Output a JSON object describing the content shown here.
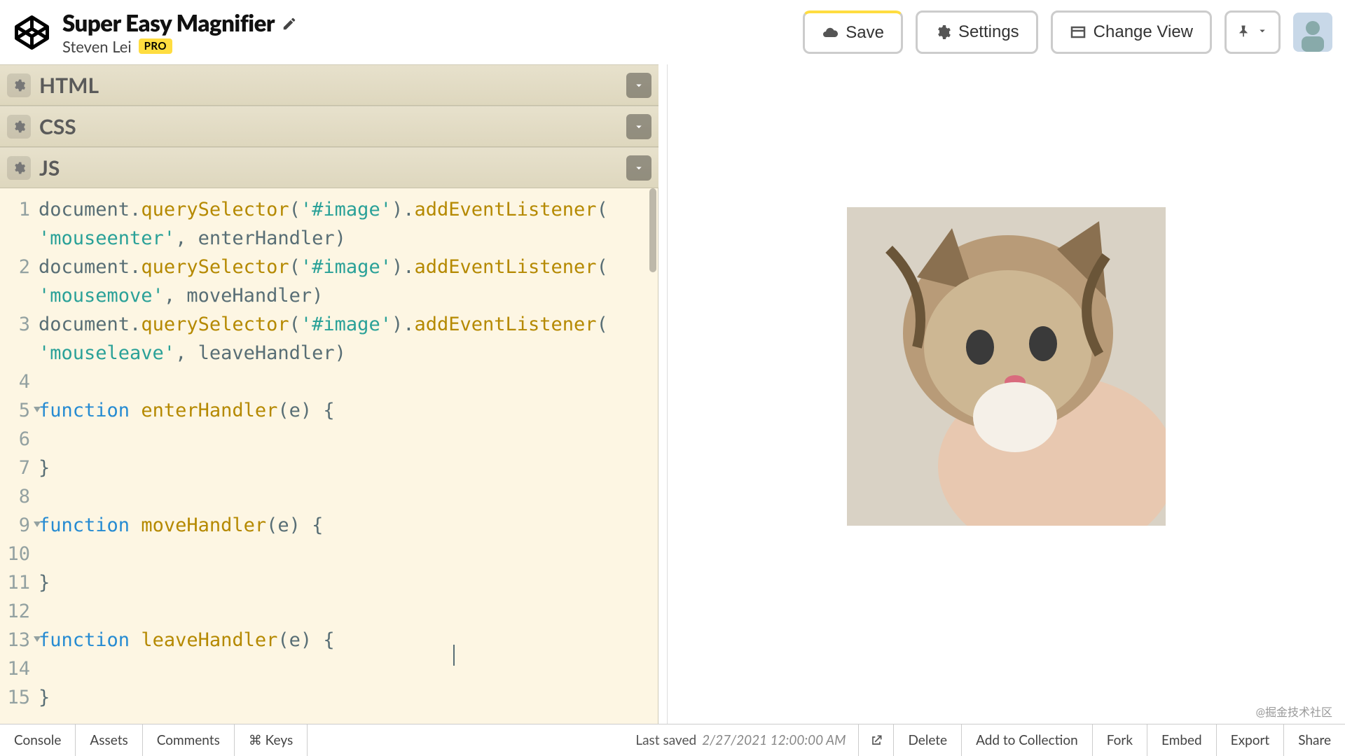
{
  "header": {
    "title": "Super Easy Magnifier",
    "author": "Steven Lei",
    "pro_badge": "PRO",
    "buttons": {
      "save": "Save",
      "settings": "Settings",
      "change_view": "Change View"
    }
  },
  "panels": {
    "html": {
      "title": "HTML"
    },
    "css": {
      "title": "CSS"
    },
    "js": {
      "title": "JS"
    }
  },
  "code": {
    "lines": [
      {
        "n": "1",
        "fold": false,
        "tokens": [
          [
            "id",
            "document"
          ],
          [
            "punct",
            "."
          ],
          [
            "method",
            "querySelector"
          ],
          [
            "punct",
            "("
          ],
          [
            "str",
            "'#image'"
          ],
          [
            "punct",
            ")."
          ],
          [
            "method",
            "addEventListener"
          ],
          [
            "punct",
            "("
          ]
        ]
      },
      {
        "n": "",
        "fold": false,
        "tokens": [
          [
            "str",
            "'mouseenter'"
          ],
          [
            "punct",
            ", "
          ],
          [
            "id",
            "enterHandler"
          ],
          [
            "punct",
            ")"
          ]
        ]
      },
      {
        "n": "2",
        "fold": false,
        "tokens": [
          [
            "id",
            "document"
          ],
          [
            "punct",
            "."
          ],
          [
            "method",
            "querySelector"
          ],
          [
            "punct",
            "("
          ],
          [
            "str",
            "'#image'"
          ],
          [
            "punct",
            ")."
          ],
          [
            "method",
            "addEventListener"
          ],
          [
            "punct",
            "("
          ]
        ]
      },
      {
        "n": "",
        "fold": false,
        "tokens": [
          [
            "str",
            "'mousemove'"
          ],
          [
            "punct",
            ", "
          ],
          [
            "id",
            "moveHandler"
          ],
          [
            "punct",
            ")"
          ]
        ]
      },
      {
        "n": "3",
        "fold": false,
        "tokens": [
          [
            "id",
            "document"
          ],
          [
            "punct",
            "."
          ],
          [
            "method",
            "querySelector"
          ],
          [
            "punct",
            "("
          ],
          [
            "str",
            "'#image'"
          ],
          [
            "punct",
            ")."
          ],
          [
            "method",
            "addEventListener"
          ],
          [
            "punct",
            "("
          ]
        ]
      },
      {
        "n": "",
        "fold": false,
        "tokens": [
          [
            "str",
            "'mouseleave'"
          ],
          [
            "punct",
            ", "
          ],
          [
            "id",
            "leaveHandler"
          ],
          [
            "punct",
            ")"
          ]
        ]
      },
      {
        "n": "4",
        "fold": false,
        "tokens": []
      },
      {
        "n": "5",
        "fold": true,
        "tokens": [
          [
            "kw",
            "function"
          ],
          [
            "punct",
            " "
          ],
          [
            "fn",
            "enterHandler"
          ],
          [
            "punct",
            "("
          ],
          [
            "id",
            "e"
          ],
          [
            "punct",
            ") {"
          ]
        ]
      },
      {
        "n": "6",
        "fold": false,
        "tokens": []
      },
      {
        "n": "7",
        "fold": false,
        "tokens": [
          [
            "punct",
            "}"
          ]
        ]
      },
      {
        "n": "8",
        "fold": false,
        "tokens": []
      },
      {
        "n": "9",
        "fold": true,
        "tokens": [
          [
            "kw",
            "function"
          ],
          [
            "punct",
            " "
          ],
          [
            "fn",
            "moveHandler"
          ],
          [
            "punct",
            "("
          ],
          [
            "id",
            "e"
          ],
          [
            "punct",
            ") {"
          ]
        ]
      },
      {
        "n": "10",
        "fold": false,
        "tokens": []
      },
      {
        "n": "11",
        "fold": false,
        "tokens": [
          [
            "punct",
            "}"
          ]
        ]
      },
      {
        "n": "12",
        "fold": false,
        "tokens": []
      },
      {
        "n": "13",
        "fold": true,
        "tokens": [
          [
            "kw",
            "function"
          ],
          [
            "punct",
            " "
          ],
          [
            "fn",
            "leaveHandler"
          ],
          [
            "punct",
            "("
          ],
          [
            "id",
            "e"
          ],
          [
            "punct",
            ") {"
          ]
        ]
      },
      {
        "n": "14",
        "fold": false,
        "tokens": []
      },
      {
        "n": "15",
        "fold": false,
        "tokens": [
          [
            "punct",
            "}"
          ]
        ]
      }
    ]
  },
  "footer": {
    "console": "Console",
    "assets": "Assets",
    "comments": "Comments",
    "keys": "⌘ Keys",
    "saved_label": "Last saved",
    "saved_date": "2/27/2021 12:00:00 AM",
    "delete": "Delete",
    "add_to_collection": "Add to Collection",
    "fork": "Fork",
    "embed": "Embed",
    "export": "Export",
    "share": "Share"
  },
  "watermark": "@掘金技术社区"
}
